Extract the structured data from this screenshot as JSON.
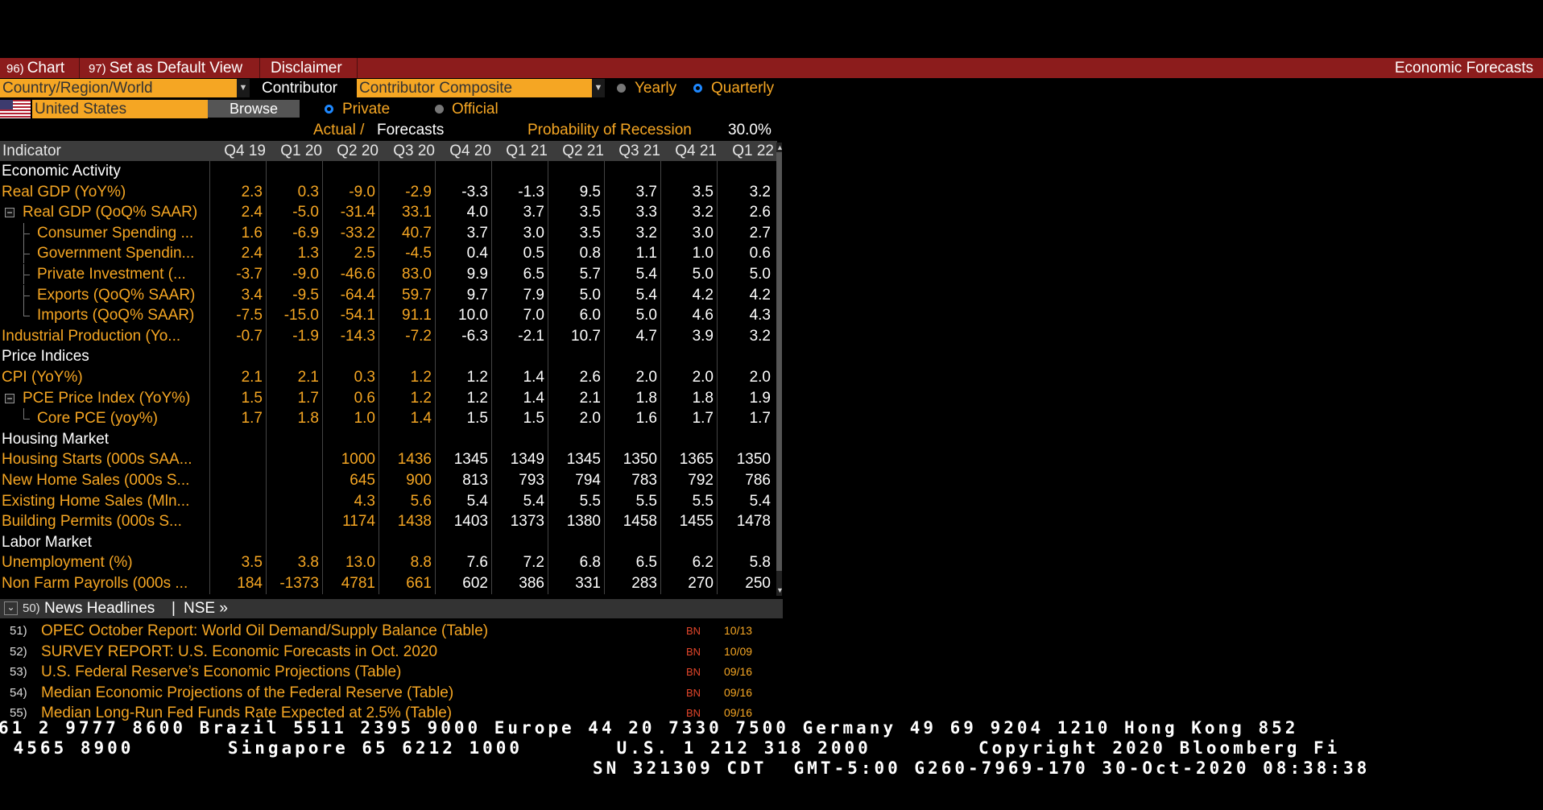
{
  "toolbar": {
    "items": [
      {
        "num": "96)",
        "label": "Chart"
      },
      {
        "num": "97)",
        "label": "Set as Default View"
      },
      {
        "num": "",
        "label": "Disclaimer"
      }
    ],
    "title": "Economic Forecasts"
  },
  "controls": {
    "region_value": "Country/Region/World",
    "contributor_label": "Contributor",
    "contributor_value": "Contributor Composite",
    "yearly_label": "Yearly",
    "quarterly_label": "Quarterly",
    "country_value": "United States",
    "browse_label": "Browse",
    "private_label": "Private",
    "official_label": "Official",
    "actual_label": "Actual /",
    "forecasts_label": "Forecasts",
    "recession_label": "Probability of Recession",
    "recession_value": "30.0%"
  },
  "table": {
    "indicator_header": "Indicator",
    "columns": [
      "Q4 19",
      "Q1 20",
      "Q2 20",
      "Q3 20",
      "Q4 20",
      "Q1 21",
      "Q2 21",
      "Q3 21",
      "Q4 21",
      "Q1 22"
    ],
    "rows": [
      {
        "type": "section",
        "name": "Economic Activity"
      },
      {
        "type": "row",
        "name": "Real GDP (YoY%)",
        "values": [
          "2.3",
          "0.3",
          "-9.0",
          "-2.9",
          "-3.3",
          "-1.3",
          "9.5",
          "3.7",
          "3.5",
          "3.2"
        ]
      },
      {
        "type": "row",
        "tree": "parent",
        "name": "Real GDP (QoQ% SAAR)",
        "values": [
          "2.4",
          "-5.0",
          "-31.4",
          "33.1",
          "4.0",
          "3.7",
          "3.5",
          "3.3",
          "3.2",
          "2.6"
        ]
      },
      {
        "type": "row",
        "tree": "child",
        "name": "Consumer Spending ...",
        "values": [
          "1.6",
          "-6.9",
          "-33.2",
          "40.7",
          "3.7",
          "3.0",
          "3.5",
          "3.2",
          "3.0",
          "2.7"
        ]
      },
      {
        "type": "row",
        "tree": "child",
        "name": "Government Spendin...",
        "values": [
          "2.4",
          "1.3",
          "2.5",
          "-4.5",
          "0.4",
          "0.5",
          "0.8",
          "1.1",
          "1.0",
          "0.6"
        ]
      },
      {
        "type": "row",
        "tree": "child",
        "name": "Private Investment (...",
        "values": [
          "-3.7",
          "-9.0",
          "-46.6",
          "83.0",
          "9.9",
          "6.5",
          "5.7",
          "5.4",
          "5.0",
          "5.0"
        ]
      },
      {
        "type": "row",
        "tree": "child",
        "name": "Exports (QoQ% SAAR)",
        "values": [
          "3.4",
          "-9.5",
          "-64.4",
          "59.7",
          "9.7",
          "7.9",
          "5.0",
          "5.4",
          "4.2",
          "4.2"
        ]
      },
      {
        "type": "row",
        "tree": "last",
        "name": "Imports (QoQ% SAAR)",
        "values": [
          "-7.5",
          "-15.0",
          "-54.1",
          "91.1",
          "10.0",
          "7.0",
          "6.0",
          "5.0",
          "4.6",
          "4.3"
        ]
      },
      {
        "type": "row",
        "name": "Industrial Production (Yo...",
        "values": [
          "-0.7",
          "-1.9",
          "-14.3",
          "-7.2",
          "-6.3",
          "-2.1",
          "10.7",
          "4.7",
          "3.9",
          "3.2"
        ]
      },
      {
        "type": "section",
        "name": "Price Indices"
      },
      {
        "type": "row",
        "name": "CPI (YoY%)",
        "values": [
          "2.1",
          "2.1",
          "0.3",
          "1.2",
          "1.2",
          "1.4",
          "2.6",
          "2.0",
          "2.0",
          "2.0"
        ]
      },
      {
        "type": "row",
        "tree": "parent",
        "name": "PCE Price Index (YoY%)",
        "values": [
          "1.5",
          "1.7",
          "0.6",
          "1.2",
          "1.2",
          "1.4",
          "2.1",
          "1.8",
          "1.8",
          "1.9"
        ]
      },
      {
        "type": "row",
        "tree": "last",
        "name": "Core PCE (yoy%)",
        "values": [
          "1.7",
          "1.8",
          "1.0",
          "1.4",
          "1.5",
          "1.5",
          "2.0",
          "1.6",
          "1.7",
          "1.7"
        ]
      },
      {
        "type": "section",
        "name": "Housing Market"
      },
      {
        "type": "row",
        "name": "Housing Starts (000s SAA...",
        "values": [
          "",
          "",
          "1000",
          "1436",
          "1345",
          "1349",
          "1345",
          "1350",
          "1365",
          "1350"
        ]
      },
      {
        "type": "row",
        "name": "New Home Sales (000s S...",
        "values": [
          "",
          "",
          "645",
          "900",
          "813",
          "793",
          "794",
          "783",
          "792",
          "786"
        ]
      },
      {
        "type": "row",
        "name": "Existing Home Sales (Mln...",
        "values": [
          "",
          "",
          "4.3",
          "5.6",
          "5.4",
          "5.4",
          "5.5",
          "5.5",
          "5.5",
          "5.4"
        ]
      },
      {
        "type": "row",
        "name": "Building Permits (000s S...",
        "values": [
          "",
          "",
          "1174",
          "1438",
          "1403",
          "1373",
          "1380",
          "1458",
          "1455",
          "1478"
        ]
      },
      {
        "type": "section",
        "name": "Labor Market"
      },
      {
        "type": "row",
        "name": "Unemployment (%)",
        "values": [
          "3.5",
          "3.8",
          "13.0",
          "8.8",
          "7.6",
          "7.2",
          "6.8",
          "6.5",
          "6.2",
          "5.8"
        ]
      },
      {
        "type": "row",
        "name": "Non Farm Payrolls (000s ...",
        "values": [
          "184",
          "-1373",
          "4781",
          "661",
          "602",
          "386",
          "331",
          "283",
          "270",
          "250"
        ]
      }
    ]
  },
  "news": {
    "header_num": "50)",
    "header_label": "News Headlines",
    "header_source": "NSE »",
    "items": [
      {
        "num": "51)",
        "title": "OPEC October Report: World Oil Demand/Supply Balance (Table)",
        "src": "BN",
        "date": "10/13"
      },
      {
        "num": "52)",
        "title": "SURVEY REPORT: U.S. Economic Forecasts in Oct. 2020",
        "src": "BN",
        "date": "10/09"
      },
      {
        "num": "53)",
        "title": "U.S. Federal Reserve’s Economic Projections (Table)",
        "src": "BN",
        "date": "09/16"
      },
      {
        "num": "54)",
        "title": "Median Economic Projections of the Federal Reserve (Table)",
        "src": "BN",
        "date": "09/16"
      },
      {
        "num": "55)",
        "title": "Median Long-Run Fed Funds Rate Expected at 2.5% (Table)",
        "src": "BN",
        "date": "09/16"
      }
    ]
  },
  "footer": {
    "line1": "61 2 9777 8600 Brazil 5511 2395 9000 Europe 44 20 7330 7500 Germany 49 69 9204 1210 Hong Kong 852",
    "line2": " 4565 8900       Singapore 65 6212 1000       U.S. 1 212 318 2000        Copyright 2020 Bloomberg Fi",
    "line3": "SN 321309 CDT  GMT-5:00 G260-7969-170 30-Oct-2020 08:38:38"
  },
  "colors": {
    "accent": "#f5a623",
    "toolbar": "#8c1c1c",
    "radio_on": "#1e88ff",
    "news_source": "#e0452a"
  }
}
